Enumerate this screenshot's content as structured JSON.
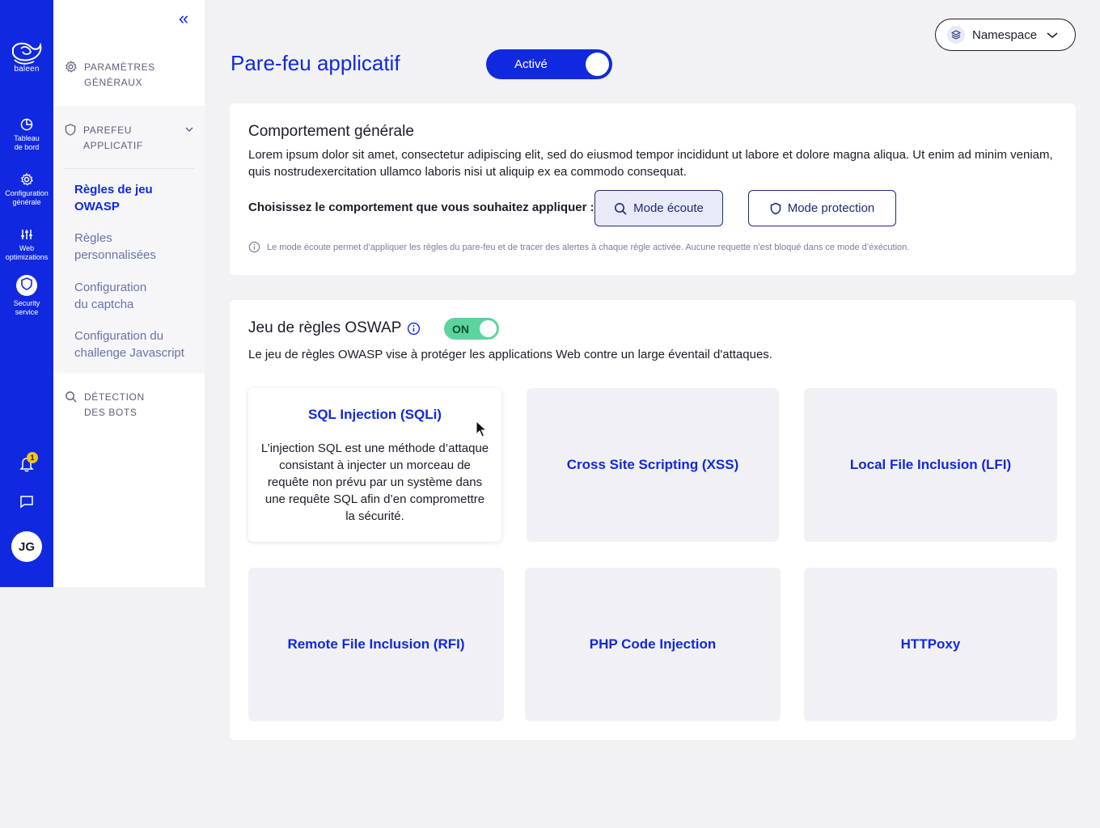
{
  "app": {
    "logo_text": "baleen"
  },
  "rail": {
    "items": [
      {
        "label_line1": "Tableau",
        "label_line2": "de bord",
        "icon": "pie-chart-icon"
      },
      {
        "label_line1": "Configuration",
        "label_line2": "générale",
        "icon": "gear-icon"
      },
      {
        "label_line1": "Web",
        "label_line2": "optimizations",
        "icon": "sliders-icon"
      },
      {
        "label_line1": "Security",
        "label_line2": "service",
        "icon": "shield-icon",
        "active": true
      }
    ],
    "notifications_count": "1",
    "avatar_initials": "JG"
  },
  "sidebar": {
    "general_params_line1": "PARAMÈTRES",
    "general_params_line2": "GÉNÉRAUX",
    "firewall_line1": "PAREFEU",
    "firewall_line2": "APPLICATIF",
    "sub_items": [
      {
        "line1": "Règles de jeu",
        "line2": "OWASP",
        "active": true
      },
      {
        "line1": "Règles",
        "line2": "personnalisées"
      },
      {
        "line1": "Configuration",
        "line2": "du captcha"
      },
      {
        "line1": "Configuration du",
        "line2": "challenge Javascript"
      }
    ],
    "bots_line1": "DÉTECTION",
    "bots_line2": "DES BOTS"
  },
  "header": {
    "title": "Pare-feu applicatif",
    "toggle_label": "Activé",
    "namespace_label": "Namespace"
  },
  "behavior": {
    "title": "Comportement générale",
    "description": "Lorem ipsum dolor sit amet, consectetur adipiscing elit, sed do eiusmod tempor incididunt ut labore et dolore magna aliqua. Ut enim ad minim veniam, quis nostrudexercitation ullamco laboris nisi ut aliquip ex ea commodo consequat.",
    "choose_label": "Choisissez le comportement que vous souhaitez appliquer :",
    "mode_listen": "Mode écoute",
    "mode_protect": "Mode protection",
    "info_text": "Le mode écoute permet d’appliquer les règles du pare-feu et de tracer des alertes à chaque règle activée. Aucune requette n’est bloqué dans ce mode d’éxécution."
  },
  "ruleset": {
    "title": "Jeu de règles OSWAP",
    "toggle_label": "ON",
    "description": "Le jeu de règles OWASP vise à protéger les applications Web contre un large éventail d'attaques.",
    "tiles": [
      {
        "title": "SQL Injection (SQLi)",
        "description": "L’injection SQL est une méthode d’attaque consistant à injecter un morceau de requête non prévu par un système dans une requête SQL afin d’en compromettre la sécurité."
      },
      {
        "title": "Cross Site Scripting (XSS)"
      },
      {
        "title": "Local File Inclusion (LFI)"
      },
      {
        "title": "Remote File Inclusion (RFI)"
      },
      {
        "title": "PHP Code Injection"
      },
      {
        "title": "HTTPoxy"
      }
    ]
  },
  "colors": {
    "brand_blue": "#1029e0",
    "toggle_green": "#5dd39e",
    "badge_yellow": "#f5c518"
  }
}
